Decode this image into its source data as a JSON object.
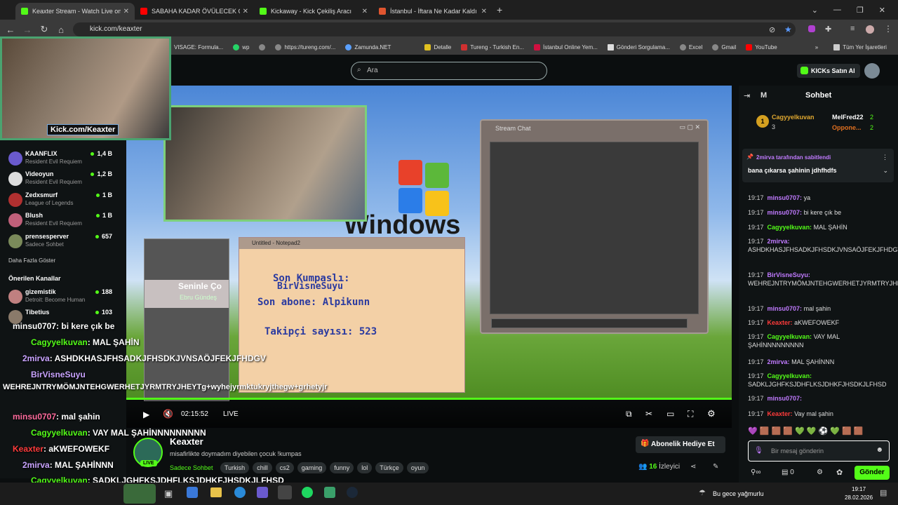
{
  "browser": {
    "tabs": [
      {
        "label": "Keaxter Stream - Watch Live on",
        "color": "#53fc18"
      },
      {
        "label": "SABAHA KADAR ÖVÜLECEK OY",
        "color": "#ff0000"
      },
      {
        "label": "Kickaway - Kick Çekiliş Aracı",
        "color": "#53fc18"
      },
      {
        "label": "İstanbul - İftara Ne Kadar Kaldı",
        "color": "#e0552f"
      }
    ],
    "url": "kick.com/keaxter",
    "bookmarks": [
      "VISAGE: Formula...",
      "wp",
      "https://tureng.com/...",
      "Zamunda.NET",
      "Detalle",
      "Tureng - Turkish En...",
      "İstanbul Online Yem...",
      "Gönderi Sorgulama...",
      "Excel",
      "Gmail",
      "YouTube"
    ],
    "bookmarks_all": "Tüm Yer İşaretleri"
  },
  "kick": {
    "search_placeholder": "Ara",
    "buy_kicks": "KICKs Satın Al",
    "cam_label": "Kick.com/Keaxter",
    "sidebar": {
      "channels": [
        {
          "name": "KAANFLIX",
          "game": "Resident Evil Requiem",
          "viewers": "1,4 B",
          "color": "#6a5acd"
        },
        {
          "name": "Videoyun",
          "game": "Resident Evil Requiem",
          "viewers": "1,2 B",
          "color": "#dddddd"
        },
        {
          "name": "Zedxsmurf",
          "game": "League of Legends",
          "viewers": "1 B",
          "color": "#b03030"
        },
        {
          "name": "Blush",
          "game": "Resident Evil Requiem",
          "viewers": "1 B",
          "color": "#c0607a"
        },
        {
          "name": "prensesperver",
          "game": "Sadece Sohbet",
          "viewers": "657",
          "color": "#7a8a5a"
        }
      ],
      "more": "Daha Fazla Göster",
      "recommended_title": "Önerilen Kanallar",
      "recommended": [
        {
          "name": "gizemistik",
          "game": "Detroit: Become Human",
          "viewers": "188",
          "color": "#c08080"
        },
        {
          "name": "Tibetius",
          "game": "",
          "viewers": "103",
          "color": "#8a7a6a"
        }
      ]
    },
    "video": {
      "stream_chat_title": "Stream Chat",
      "notepad_title": "Untitled - Notepad2",
      "np1": "Son Kumpaslı:",
      "np2": "BirVisneSuyu",
      "np3": "Son abone: Alpikunn",
      "np4": "Takipçi sayısı: 523",
      "winamp_song": "Seninle Ço",
      "winamp_artist": "Ebru Gündeş",
      "windows": "Windows",
      "overlay_chat": [
        {
          "user": "minsu0707",
          "msg": ": bi kere çık be",
          "color": "#ff6b9d"
        },
        {
          "user": "Cagyyelkuvan",
          "msg": ": MAL ŞAHİN",
          "color": "#53fc18"
        },
        {
          "user": "2mirva",
          "msg": ": ASHDKHASJFHSADKJFHSDKJVNSAÖJFEKJFHDGV",
          "color": "#c9a3ff"
        },
        {
          "user": "BirVisneSuyu",
          "msg": "",
          "color": "#c9a3ff"
        },
        {
          "user": "",
          "msg": "WEHREJNTRYMÖMJNTEHGWERHETJYRMTRYJHEYTg+wyhejyrmktukryjthegw+grhetyjr",
          "color": "#fff"
        },
        {
          "user": "minsu0707",
          "msg": ": mal şahin",
          "color": "#ff6b9d"
        },
        {
          "user": "Cagyyelkuvan",
          "msg": ": VAY MAL ŞAHİNNNNNNNNN",
          "color": "#53fc18"
        },
        {
          "user": "Keaxter",
          "msg": ": aKWEFOWEKF",
          "color": "#ff3b3b"
        },
        {
          "user": "2mirva",
          "msg": ": MAL ŞAHİNNN",
          "color": "#c9a3ff"
        },
        {
          "user": "Cagyyelkuvan",
          "msg": ": SADKLJGHFKSJDHFLKSJDHKFJHSDKJLFHSD",
          "color": "#53fc18"
        }
      ],
      "time": "02:15:52",
      "live": "LIVE"
    },
    "channel": {
      "name": "Keaxter",
      "title": "misafirlikte doymadım diyebilen çocuk !kumpas",
      "category": "Sadece Sohbet",
      "tags": [
        "Turkish",
        "chill",
        "cs2",
        "gaming",
        "funny",
        "lol",
        "Türkçe",
        "oyun"
      ],
      "live_badge": "LIVE",
      "gift_sub": "Abonelik Hediye Et",
      "viewers": "16",
      "viewers_label": "İzleyici"
    },
    "chat": {
      "header": "Sohbet",
      "m": "M",
      "leaderboard": [
        {
          "user": "Cagyyelkuvan",
          "count": "3"
        },
        {
          "user": "MelFred22",
          "count": "2"
        },
        {
          "user": "Oppone...",
          "count": "2"
        }
      ],
      "pinned_by": "2mirva tarafından sabitlendi",
      "pinned_msg": "bana çıkarsa şahinin jdhfhdfs",
      "messages": [
        {
          "time": "19:17",
          "user": "minsu0707:",
          "text": "ya",
          "color": "#c07aff"
        },
        {
          "time": "19:17",
          "user": "minsu0707:",
          "text": "bi kere çık be",
          "color": "#c07aff"
        },
        {
          "time": "19:17",
          "user": "Cagyyelkuvan:",
          "text": "MAL ŞAHİN",
          "color": "#53fc18"
        },
        {
          "time": "19:17",
          "user": "2mirva:",
          "text": "ASHDKHASJFHSADKJFHSDKJVNSAÖJFEKJFHDGV",
          "color": "#c07aff"
        },
        {
          "time": "19:17",
          "user": "BirVisneSuyu:",
          "text": "WEHREJNTRYMÖMJNTEHGWERHETJYRMTRYJHEYTg+wyhejyrmktukryjthegw+grhetyjrut",
          "color": "#c07aff"
        },
        {
          "time": "19:17",
          "user": "minsu0707:",
          "text": "mal şahin",
          "color": "#c07aff"
        },
        {
          "time": "19:17",
          "user": "Keaxter:",
          "text": "aKWEFOWEKF",
          "color": "#ff3b3b"
        },
        {
          "time": "19:17",
          "user": "Cagyyelkuvan:",
          "text": "VAY MAL ŞAHİNNNNNNNNN",
          "color": "#53fc18"
        },
        {
          "time": "19:17",
          "user": "2mirva:",
          "text": "MAL ŞAHİNNN",
          "color": "#c07aff"
        },
        {
          "time": "19:17",
          "user": "Cagyyelkuvan:",
          "text": "SADKLJGHFKSJDHFLKSJDHKFJHSDKJLFHSD",
          "color": "#53fc18"
        },
        {
          "time": "19:17",
          "user": "minsu0707:",
          "text": "",
          "color": "#c07aff"
        },
        {
          "time": "19:17",
          "user": "Keaxter:",
          "text": "Vay mal şahin",
          "color": "#ff3b3b"
        }
      ],
      "input_placeholder": "Bir mesaj gönderin",
      "kicks_count": "0",
      "send": "Gönder"
    }
  },
  "taskbar": {
    "weather": "Bu gece yağmurlu",
    "time": "19:17",
    "date": "28.02.2026"
  }
}
